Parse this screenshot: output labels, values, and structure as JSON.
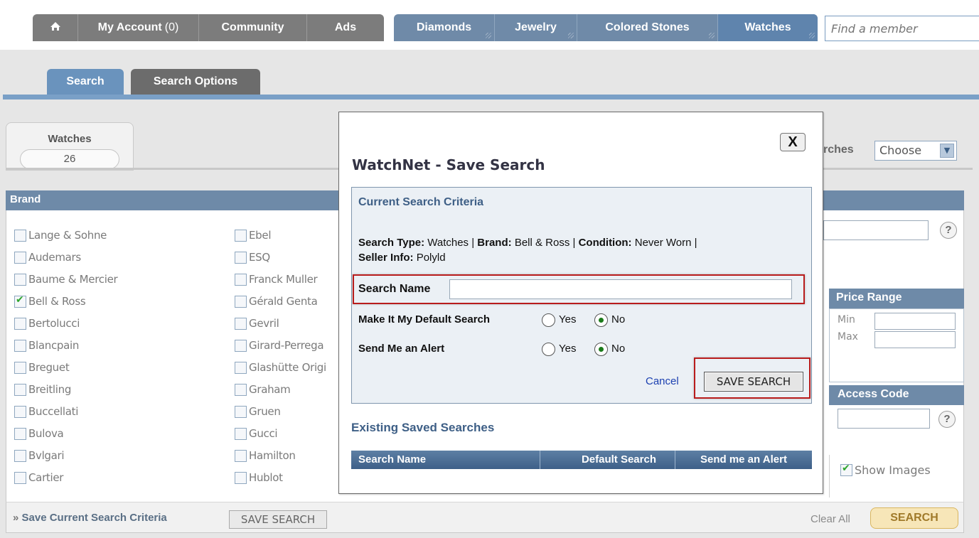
{
  "nav": {
    "home_icon": "home-icon",
    "my_account_label": "My Account",
    "my_account_count": "(0)",
    "community_label": "Community",
    "ads_label": "Ads",
    "diamonds_label": "Diamonds",
    "jewelry_label": "Jewelry",
    "colored_stones_label": "Colored Stones",
    "watches_label": "Watches",
    "find_member_placeholder": "Find a member"
  },
  "subtabs": {
    "search_label": "Search",
    "search_options_label": "Search Options"
  },
  "watches_counter": {
    "label": "Watches",
    "count": "26"
  },
  "brand_panel": {
    "title": "Brand",
    "col1": [
      {
        "label": "Lange & Sohne",
        "checked": false
      },
      {
        "label": "Audemars",
        "checked": false
      },
      {
        "label": "Baume & Mercier",
        "checked": false
      },
      {
        "label": "Bell & Ross",
        "checked": true
      },
      {
        "label": "Bertolucci",
        "checked": false
      },
      {
        "label": "Blancpain",
        "checked": false
      },
      {
        "label": "Breguet",
        "checked": false
      },
      {
        "label": "Breitling",
        "checked": false
      },
      {
        "label": "Buccellati",
        "checked": false
      },
      {
        "label": "Bulova",
        "checked": false
      },
      {
        "label": "Bvlgari",
        "checked": false
      },
      {
        "label": "Cartier",
        "checked": false
      }
    ],
    "col2": [
      {
        "label": "Ebel",
        "checked": false
      },
      {
        "label": "ESQ",
        "checked": false
      },
      {
        "label": "Franck Muller",
        "checked": false
      },
      {
        "label": "Gérald Genta",
        "checked": false
      },
      {
        "label": "Gevril",
        "checked": false
      },
      {
        "label": "Girard-Perrega",
        "checked": false
      },
      {
        "label": "Glashütte Origi",
        "checked": false
      },
      {
        "label": "Graham",
        "checked": false
      },
      {
        "label": "Gruen",
        "checked": false
      },
      {
        "label": "Gucci",
        "checked": false
      },
      {
        "label": "Hamilton",
        "checked": false
      },
      {
        "label": "Hublot",
        "checked": false
      }
    ]
  },
  "right_panel": {
    "saved_searches_fragment": "rches",
    "choose_value": "Choose",
    "price_range_title": "Price Range",
    "min_label": "Min",
    "max_label": "Max",
    "access_code_title": "Access Code",
    "help_glyph": "?",
    "show_images_label": "Show Images",
    "show_images_checked": true
  },
  "bottom_bar": {
    "raquo": "»",
    "save_criteria_label": "Save Current Search Criteria",
    "save_search_button": "SAVE SEARCH",
    "clear_all_label": "Clear All",
    "search_button": "SEARCH"
  },
  "modal": {
    "close_glyph": "X",
    "title": "WatchNet - Save Search",
    "criteria_heading": "Current Search Criteria",
    "search_type_label": "Search Type:",
    "search_type_value": "Watches |",
    "brand_label": "Brand:",
    "brand_value": "Bell & Ross |",
    "condition_label": "Condition:",
    "condition_value": "Never Worn |",
    "seller_info_label": "Seller Info:",
    "seller_info_value": "Polyld",
    "search_name_label": "Search Name",
    "search_name_value": "",
    "default_search_label": "Make It My Default Search",
    "alert_label": "Send Me an Alert",
    "yes_label": "Yes",
    "no_label": "No",
    "default_search_selected": "No",
    "alert_selected": "No",
    "cancel_label": "Cancel",
    "save_button_label": "SAVE SEARCH",
    "existing_heading": "Existing Saved Searches",
    "table_headers": [
      "Search Name",
      "Default Search",
      "Send me an Alert"
    ]
  },
  "colors": {
    "nav_gray": "#7c7c7c",
    "nav_blue": "#6f8aa8",
    "section_head": "#6e8aa8",
    "highlight_red": "#b91c1c",
    "link_blue": "#1a3fb0"
  }
}
